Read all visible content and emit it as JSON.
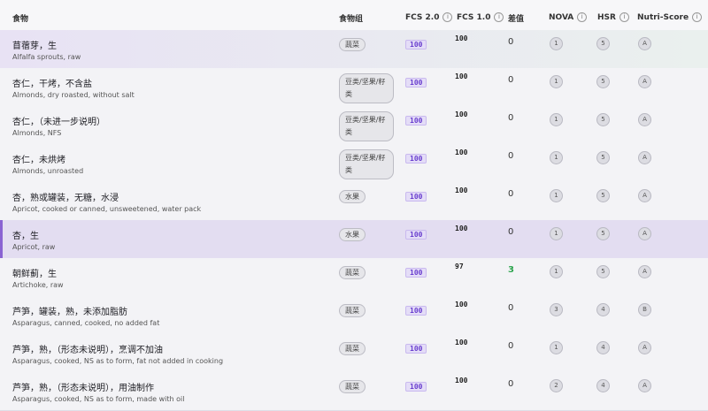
{
  "header": {
    "food": "食物",
    "group": "食物组",
    "fcs2": "FCS 2.0",
    "fcs1": "FCS 1.0",
    "diff": "差值",
    "nova": "NOVA",
    "hsr": "HSR",
    "nutri": "Nutri-Score",
    "info_glyph": "i"
  },
  "rows": [
    {
      "zh": "苜蓿芽，生",
      "en": "Alfalfa sprouts, raw",
      "group": "蔬菜",
      "fcs2": "100",
      "fcs1": "100",
      "diff": "0",
      "nova": "1",
      "hsr": "5",
      "nutri": "A"
    },
    {
      "zh": "杏仁，干烤，不含盐",
      "en": "Almonds, dry roasted, without salt",
      "group": "豆类/坚果/籽类",
      "fcs2": "100",
      "fcs1": "100",
      "diff": "0",
      "nova": "1",
      "hsr": "5",
      "nutri": "A"
    },
    {
      "zh": "杏仁，（未进一步说明）",
      "en": "Almonds, NFS",
      "group": "豆类/坚果/籽类",
      "fcs2": "100",
      "fcs1": "100",
      "diff": "0",
      "nova": "1",
      "hsr": "5",
      "nutri": "A"
    },
    {
      "zh": "杏仁，未烘烤",
      "en": "Almonds, unroasted",
      "group": "豆类/坚果/籽类",
      "fcs2": "100",
      "fcs1": "100",
      "diff": "0",
      "nova": "1",
      "hsr": "5",
      "nutri": "A"
    },
    {
      "zh": "杏，熟或罐装，无糖，水浸",
      "en": "Apricot, cooked or canned, unsweetened, water pack",
      "group": "水果",
      "fcs2": "100",
      "fcs1": "100",
      "diff": "0",
      "nova": "1",
      "hsr": "5",
      "nutri": "A"
    },
    {
      "zh": "杏，生",
      "en": "Apricot, raw",
      "group": "水果",
      "fcs2": "100",
      "fcs1": "100",
      "diff": "0",
      "nova": "1",
      "hsr": "5",
      "nutri": "A"
    },
    {
      "zh": "朝鲜蓟，生",
      "en": "Artichoke, raw",
      "group": "蔬菜",
      "fcs2": "100",
      "fcs1": "97",
      "diff": "3",
      "nova": "1",
      "hsr": "5",
      "nutri": "A"
    },
    {
      "zh": "芦笋，罐装，熟，未添加脂肪",
      "en": "Asparagus, canned, cooked, no added fat",
      "group": "蔬菜",
      "fcs2": "100",
      "fcs1": "100",
      "diff": "0",
      "nova": "3",
      "hsr": "4",
      "nutri": "B"
    },
    {
      "zh": "芦笋，熟，（形态未说明），烹调不加油",
      "en": "Asparagus, cooked, NS as to form, fat not added in cooking",
      "group": "蔬菜",
      "fcs2": "100",
      "fcs1": "100",
      "diff": "0",
      "nova": "1",
      "hsr": "4",
      "nutri": "A"
    },
    {
      "zh": "芦笋，熟，（形态未说明），用油制作",
      "en": "Asparagus, cooked, NS as to form, made with oil",
      "group": "蔬菜",
      "fcs2": "100",
      "fcs1": "100",
      "diff": "0",
      "nova": "2",
      "hsr": "4",
      "nutri": "A"
    }
  ]
}
